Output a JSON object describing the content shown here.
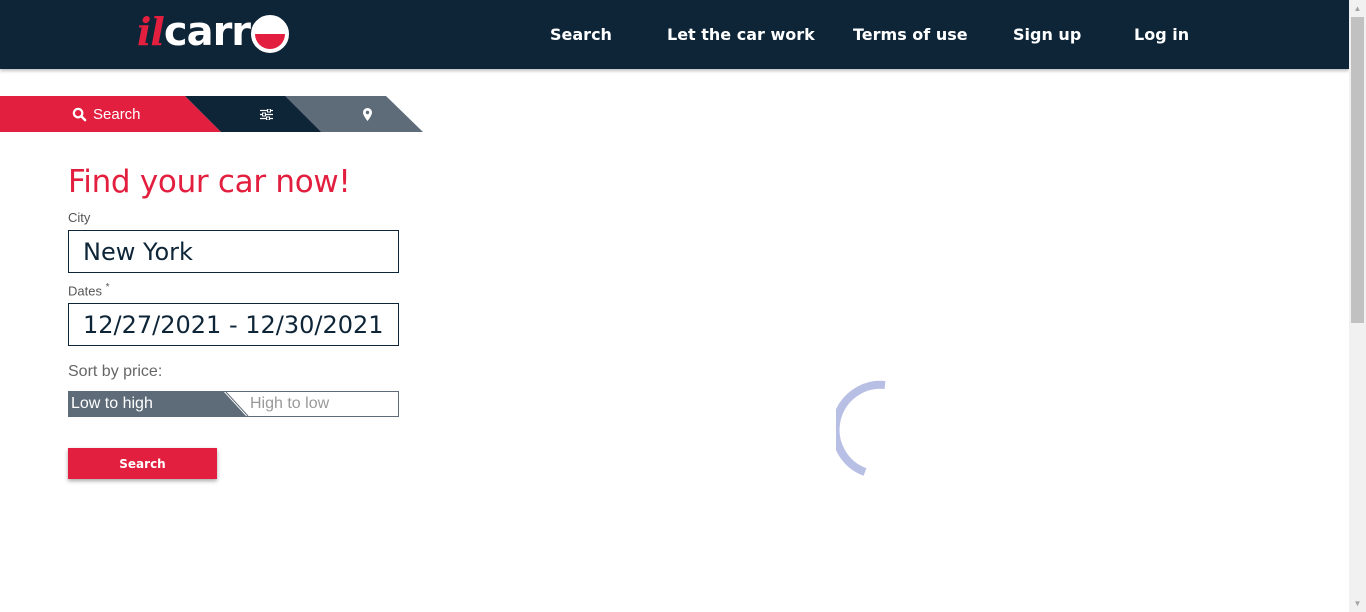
{
  "header": {
    "logo": {
      "il": "il",
      "carro": "carr"
    },
    "nav": [
      "Search",
      "Let the car work",
      "Terms of use",
      "Sign up",
      "Log in"
    ]
  },
  "tabs": {
    "search_label": "Search",
    "filter_icon": "sliders-icon",
    "map_icon": "map-marker-icon"
  },
  "form": {
    "title": "Find your car now!",
    "city_label": "City",
    "city_value": "New York",
    "dates_label": "Dates",
    "dates_required": "*",
    "dates_value": "12/27/2021 - 12/30/2021",
    "sort_label": "Sort by price:",
    "sort_low": "Low to high",
    "sort_high": "High to low",
    "sort_selected": "Low to high",
    "search_button": "Search"
  },
  "loading": {
    "icon": "loading-spinner"
  },
  "colors": {
    "navy": "#0e2538",
    "red": "#e31f3f",
    "slate": "#5e6c79",
    "spinner": "#b8bfe4"
  }
}
